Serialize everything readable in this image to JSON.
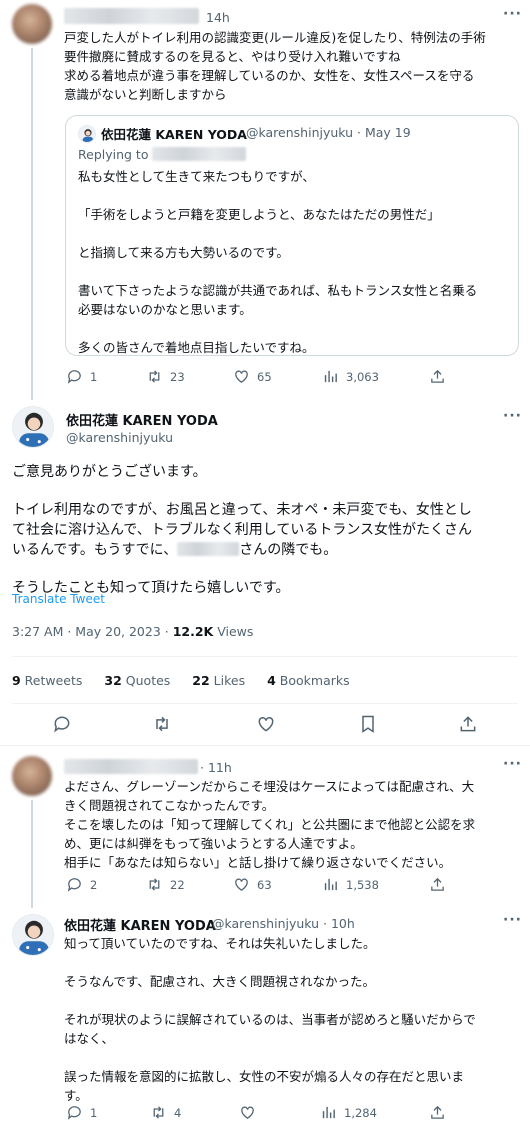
{
  "tweet1": {
    "time": "14h",
    "lines": [
      "戸変した人がトイレ利用の認識変更(ルール違反)を促したり、特例法の手術",
      "要件撤廃に賛成するのを見ると、やはり受け入れ難いですね",
      "求める着地点が違う事を理解しているのか、女性を、女性スペースを守る",
      "意識がないと判断しますから"
    ],
    "quote": {
      "name": "依田花蓮 KAREN YODA",
      "handle_date": "@karenshinjyuku · May 19",
      "replying_to": "Replying to",
      "paragraphs": [
        [
          "私も女性として生きて来たつもりですが、"
        ],
        [
          "「手術をしようと戸籍を変更しようと、あなたはただの男性だ」"
        ],
        [
          "と指摘して来る方も大勢いるのです。"
        ],
        [
          "書いて下さったような認識が共通であれば、私もトランス女性と名乗る",
          "必要はないのかなと思います。"
        ],
        [
          "多くの皆さんで着地点目指したいですね。"
        ]
      ]
    },
    "actions": {
      "replies": "1",
      "retweets": "23",
      "likes": "65",
      "views": "3,063"
    }
  },
  "main_tweet": {
    "name": "依田花蓮 KAREN YODA",
    "handle": "@karenshinjyuku",
    "paragraphs": [
      [
        "ご意見ありがとうございます。"
      ],
      [
        "トイレ利用なのですが、お風呂と違って、未オペ・未戸変でも、女性とし",
        "て社会に溶け込んで、トラブルなく利用しているトランス女性がたくさん"
      ],
      [
        "さんの隣でも。"
      ],
      [
        "そうしたことも知って頂けたら嬉しいです。"
      ]
    ],
    "line3_prefix": "いるんです。もうすでに、",
    "translate": "Translate Tweet",
    "timestamp": "3:27 AM · May 20, 2023 · ",
    "views_count": "12.2K",
    "views_label": " Views",
    "stats": [
      {
        "count": "9",
        "label": " Retweets"
      },
      {
        "count": "32",
        "label": " Quotes"
      },
      {
        "count": "22",
        "label": " Likes"
      },
      {
        "count": "4",
        "label": " Bookmarks"
      }
    ]
  },
  "tweet3": {
    "time": "· 11h",
    "lines": [
      "よださん、グレーゾーンだからこそ埋没はケースによっては配慮され、大",
      "きく問題視されてこなかったんです。",
      "そこを壊したのは「知って理解してくれ」と公共圏にまで他認と公認を求",
      "め、更には糾弾をもって強いようとする人達ですよ。",
      "相手に「あなたは知らない」と話し掛けて繰り返さないでください。"
    ],
    "actions": {
      "replies": "2",
      "retweets": "22",
      "likes": "63",
      "views": "1,538"
    }
  },
  "tweet4": {
    "name": "依田花蓮 KAREN YODA",
    "handle_time": "@karenshinjyuku · 10h",
    "paragraphs": [
      [
        "知って頂いていたのですね、それは失礼いたしました。"
      ],
      [
        "そうなんです、配慮され、大きく問題視されなかった。"
      ],
      [
        "それが現状のように誤解されているのは、当事者が認めろと騒いだからで",
        "はなく、"
      ],
      [
        "誤った情報を意図的に拡散し、女性の不安が煽る人々の存在だと思いま",
        "す。"
      ]
    ],
    "actions": {
      "replies": "1",
      "retweets": "4",
      "likes": "",
      "views": "1,284"
    }
  },
  "icons": [
    "reply-icon",
    "retweet-icon",
    "like-icon",
    "views-icon",
    "share-icon",
    "bookmark-icon",
    "more-icon"
  ],
  "colors": {
    "text": "#0f1419",
    "muted": "#536471",
    "link": "#1d9bf0",
    "border": "#cfd9de"
  }
}
